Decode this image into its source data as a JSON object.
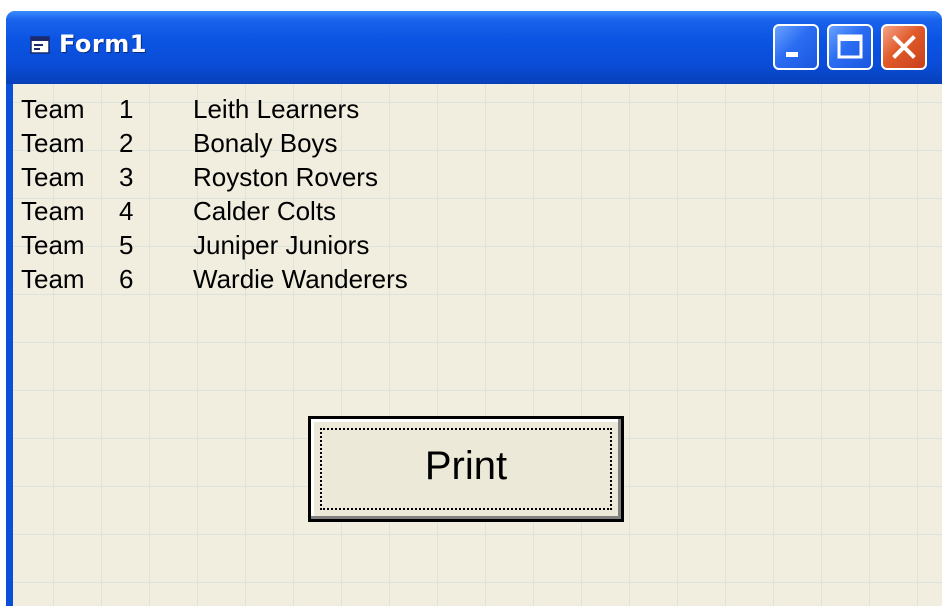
{
  "window": {
    "title": "Form1",
    "icon": "form-app-icon",
    "controls": {
      "minimize": "minimize-icon",
      "maximize": "maximize-icon",
      "close": "close-icon"
    },
    "colors": {
      "titlebar": "#0a4fd8",
      "client_background": "#f1eee0",
      "close_button": "#e05a2a"
    }
  },
  "teams": [
    {
      "label": "Team",
      "number": "1",
      "name": "Leith Learners"
    },
    {
      "label": "Team",
      "number": "2",
      "name": "Bonaly Boys"
    },
    {
      "label": "Team",
      "number": "3",
      "name": "Royston Rovers"
    },
    {
      "label": "Team",
      "number": "4",
      "name": "Calder Colts"
    },
    {
      "label": "Team",
      "number": "5",
      "name": "Juniper Juniors"
    },
    {
      "label": "Team",
      "number": "6",
      "name": "Wardie Wanderers"
    }
  ],
  "print_button": {
    "label": "Print"
  }
}
